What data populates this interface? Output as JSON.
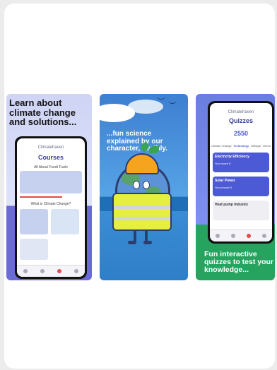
{
  "screenshots": [
    {
      "headline": "Learn about climate change and solutions...",
      "phone": {
        "app_name": "Climatehaven",
        "heading": "Courses",
        "sections": [
          "All About Fossil Fuels",
          "What is Climate Change?"
        ]
      }
    },
    {
      "headline": "...fun science explained by our character, Earthly."
    },
    {
      "headline": "Fun interactive quizzes to test your knowledge...",
      "phone": {
        "app_name": "Climatehaven",
        "heading": "Quizzes",
        "score": "2550",
        "tabs": [
          "Climate Change",
          "Technology",
          "Lifestyle",
          "Green"
        ],
        "items": [
          {
            "title": "Electricity Efficiency",
            "sub": "Your score 8"
          },
          {
            "title": "Solar Power",
            "sub": "Your record 5"
          },
          {
            "title": "Heat pump industry",
            "sub": ""
          }
        ]
      }
    }
  ]
}
